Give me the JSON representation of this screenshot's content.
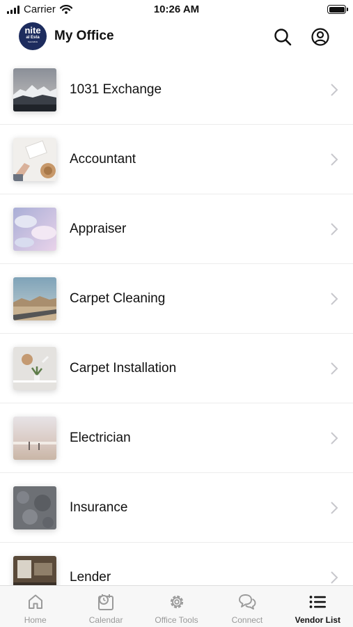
{
  "status_bar": {
    "carrier": "Carrier",
    "time": "10:26 AM"
  },
  "header": {
    "logo": {
      "line1": "nite",
      "line2": "al Esta",
      "line3": "Specialists"
    },
    "title": "My Office"
  },
  "vendors": [
    {
      "label": "1031 Exchange",
      "thumb_icon": "mountain-photo"
    },
    {
      "label": "Accountant",
      "thumb_icon": "desk-hat-photo"
    },
    {
      "label": "Appraiser",
      "thumb_icon": "clouds-photo"
    },
    {
      "label": "Carpet Cleaning",
      "thumb_icon": "desert-road-photo"
    },
    {
      "label": "Carpet Installation",
      "thumb_icon": "plant-shelf-photo"
    },
    {
      "label": "Electrician",
      "thumb_icon": "beach-sunset-photo"
    },
    {
      "label": "Insurance",
      "thumb_icon": "stone-texture-photo"
    },
    {
      "label": "Lender",
      "thumb_icon": "room-photo"
    }
  ],
  "tabs": [
    {
      "label": "Home",
      "icon": "home-icon",
      "active": false
    },
    {
      "label": "Calendar",
      "icon": "calendar-icon",
      "active": false
    },
    {
      "label": "Office Tools",
      "icon": "gear-icon",
      "active": false
    },
    {
      "label": "Connect",
      "icon": "chat-bubbles-icon",
      "active": false
    },
    {
      "label": "Vendor List",
      "icon": "list-icon",
      "active": true
    }
  ],
  "colors": {
    "logo_bg": "#1d2c5e",
    "active_tab": "#111111",
    "inactive_tab": "#999999",
    "chevron": "#c7c7cc"
  }
}
